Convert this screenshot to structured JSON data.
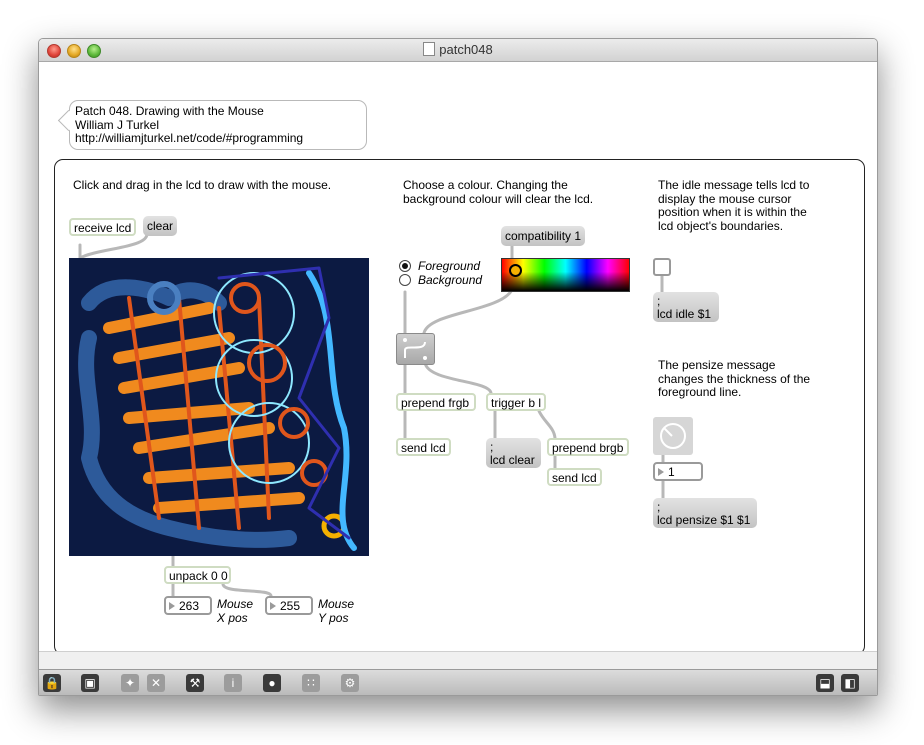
{
  "window": {
    "title": "patch048"
  },
  "header_comment": "Patch 048. Drawing with the Mouse\nWilliam J Turkel\nhttp://williamjturkel.net/code/#programming",
  "comments": {
    "draw_instruction": "Click and drag in the lcd to draw with the mouse.",
    "colour_instruction": "Choose a colour. Changing the\nbackground colour will clear the lcd.",
    "idle_instruction": "The idle message tells lcd to\ndisplay the mouse cursor\nposition when it is within the\nlcd object's boundaries.",
    "pensize_instruction": "The pensize message\nchanges the thickness of the\nforeground line.",
    "mouse_x_label": "Mouse\nX pos",
    "mouse_y_label": "Mouse\nY pos"
  },
  "objects": {
    "receive_lcd": "receive lcd",
    "unpack": "unpack 0 0",
    "prepend_frgb": "prepend frgb",
    "send_lcd_1": "send lcd",
    "trigger": "trigger b l",
    "prepend_brgb": "prepend brgb",
    "send_lcd_2": "send lcd"
  },
  "messages": {
    "clear": "clear",
    "compatibility": "compatibility 1",
    "lcd_clear": ";\nlcd clear",
    "lcd_idle": ";\nlcd idle $1",
    "lcd_pensize": ";\nlcd pensize $1 $1"
  },
  "radio": {
    "options": [
      "Foreground",
      "Background"
    ],
    "selected": "Foreground"
  },
  "numbers": {
    "mouse_x": "263",
    "mouse_y": "255",
    "pensize": "1"
  },
  "colors": {
    "lcd_background": "#0c1a42",
    "cord": "#b8b8b8",
    "object_border": "#cfdcc2",
    "accent_orange": "#f08a1e",
    "accent_cyan": "#7fe8ff"
  },
  "toolbar": {
    "left_icons": [
      "lock-icon",
      "presentation-icon",
      "palette-icon",
      "close-icon",
      "debug-icon",
      "info-icon",
      "connection-icon",
      "grid-icon",
      "gear-icon"
    ],
    "right_icons": [
      "bottom-panel-icon",
      "sidebar-icon"
    ]
  }
}
